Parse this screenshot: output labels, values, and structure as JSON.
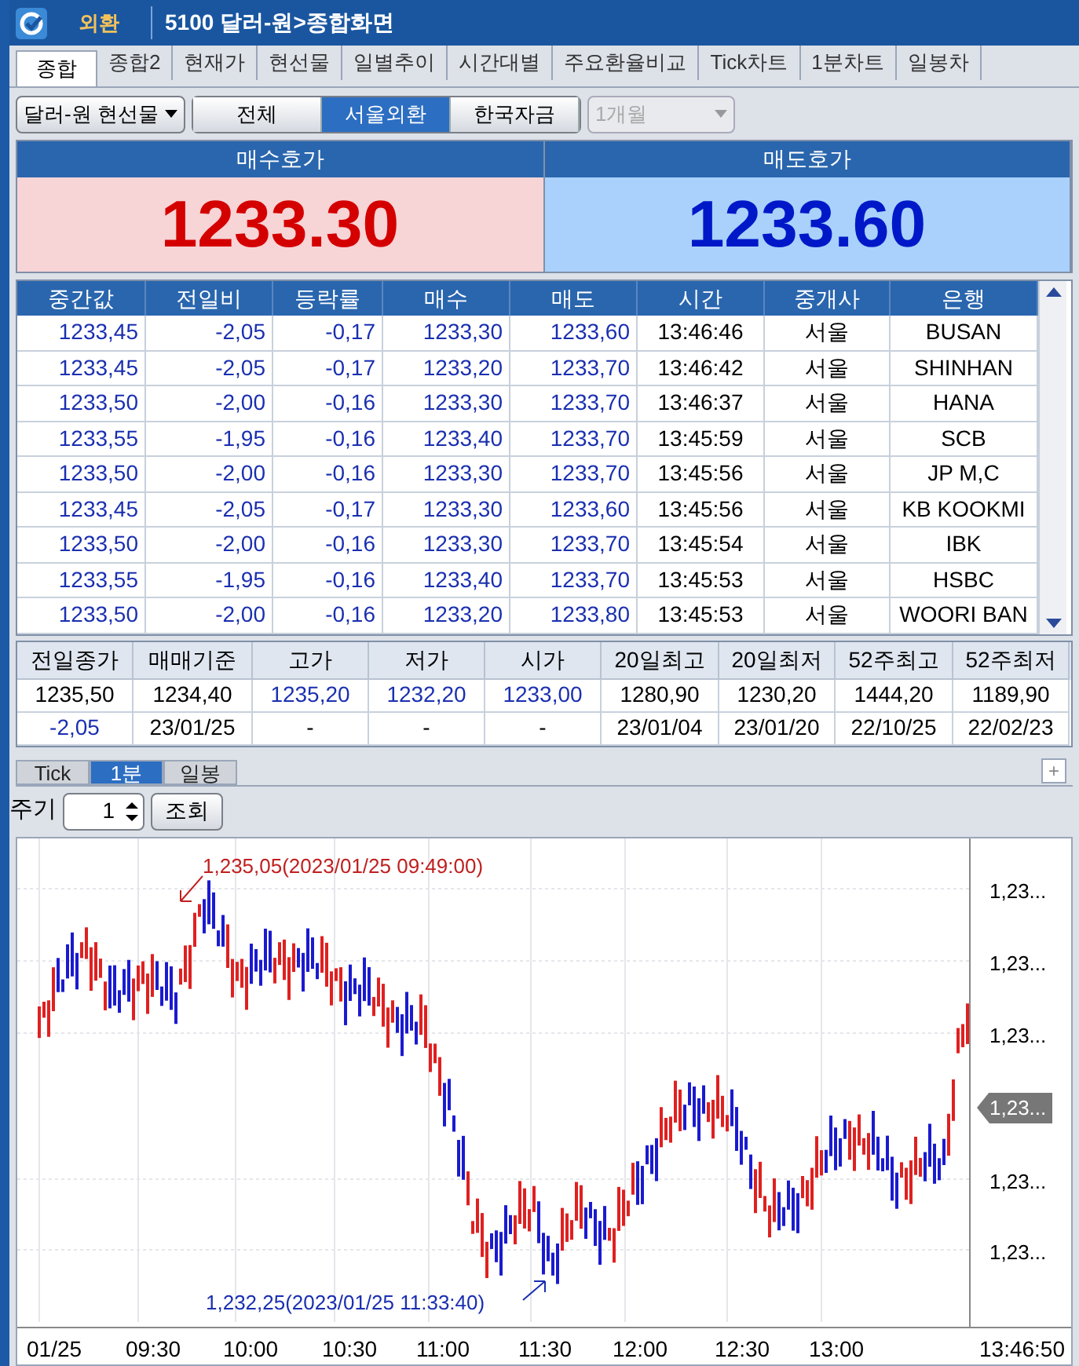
{
  "window": {
    "menu": "외환",
    "title": "5100 달러-원>종합화면"
  },
  "tabs": [
    {
      "label": "종합",
      "selected": true
    },
    {
      "label": "종합2",
      "selected": false
    },
    {
      "label": "현재가",
      "selected": false
    },
    {
      "label": "현선물",
      "selected": false
    },
    {
      "label": "일별추이",
      "selected": false
    },
    {
      "label": "시간대별",
      "selected": false
    },
    {
      "label": "주요환율비교",
      "selected": false
    },
    {
      "label": "Tick차트",
      "selected": false
    },
    {
      "label": "1분차트",
      "selected": false
    },
    {
      "label": "일봉차",
      "selected": false
    }
  ],
  "market_select": {
    "value": "달러-원 현선물"
  },
  "segments": [
    {
      "label": "전체",
      "selected": false
    },
    {
      "label": "서울외환",
      "selected": true
    },
    {
      "label": "한국자금",
      "selected": false
    }
  ],
  "period_select": {
    "value": "1개월",
    "disabled": true
  },
  "quotes": [
    {
      "label": "매수호가",
      "price": "1233.30",
      "color": "#d40000"
    },
    {
      "label": "매도호가",
      "price": "1233.60",
      "color": "#0018c8"
    }
  ],
  "table": {
    "columns": [
      {
        "label": "중간값",
        "color": "#1a2fb0"
      },
      {
        "label": "전일비",
        "color": "#1a2fb0"
      },
      {
        "label": "등락률",
        "color": "#1a2fb0"
      },
      {
        "label": "매수",
        "color": "#1a2fb0"
      },
      {
        "label": "매도",
        "color": "#1a2fb0"
      },
      {
        "label": "시간",
        "color": "#000000"
      },
      {
        "label": "중개사",
        "color": "#000000"
      },
      {
        "label": "은행",
        "color": "#000000"
      }
    ],
    "rows": [
      [
        "1233,45",
        "-2,05",
        "-0,17",
        "1233,30",
        "1233,60",
        "13:46:46",
        "서울",
        "BUSAN"
      ],
      [
        "1233,45",
        "-2,05",
        "-0,17",
        "1233,20",
        "1233,70",
        "13:46:42",
        "서울",
        "SHINHAN"
      ],
      [
        "1233,50",
        "-2,00",
        "-0,16",
        "1233,30",
        "1233,70",
        "13:46:37",
        "서울",
        "HANA"
      ],
      [
        "1233,55",
        "-1,95",
        "-0,16",
        "1233,40",
        "1233,70",
        "13:45:59",
        "서울",
        "SCB"
      ],
      [
        "1233,50",
        "-2,00",
        "-0,16",
        "1233,30",
        "1233,70",
        "13:45:56",
        "서울",
        "JP M,C"
      ],
      [
        "1233,45",
        "-2,05",
        "-0,17",
        "1233,30",
        "1233,60",
        "13:45:56",
        "서울",
        "KB KOOKMI"
      ],
      [
        "1233,50",
        "-2,00",
        "-0,16",
        "1233,30",
        "1233,70",
        "13:45:54",
        "서울",
        "IBK"
      ],
      [
        "1233,55",
        "-1,95",
        "-0,16",
        "1233,40",
        "1233,70",
        "13:45:53",
        "서울",
        "HSBC"
      ],
      [
        "1233,50",
        "-2,00",
        "-0,16",
        "1233,20",
        "1233,80",
        "13:45:53",
        "서울",
        "WOORI BAN"
      ]
    ]
  },
  "summary": {
    "columns": [
      "전일종가",
      "매매기준",
      "고가",
      "저가",
      "시가",
      "20일최고",
      "20일최저",
      "52주최고",
      "52주최저"
    ],
    "rows": [
      [
        {
          "text": "1235,50",
          "color": "#000000"
        },
        {
          "text": "1234,40",
          "color": "#000000"
        },
        {
          "text": "1235,20",
          "color": "#1a2fb0"
        },
        {
          "text": "1232,20",
          "color": "#1a2fb0"
        },
        {
          "text": "1233,00",
          "color": "#1a2fb0"
        },
        {
          "text": "1280,90",
          "color": "#000000"
        },
        {
          "text": "1230,20",
          "color": "#000000"
        },
        {
          "text": "1444,20",
          "color": "#000000"
        },
        {
          "text": "1189,90",
          "color": "#000000"
        }
      ],
      [
        {
          "text": "-2,05",
          "color": "#1a2fb0"
        },
        {
          "text": "23/01/25",
          "color": "#000000"
        },
        {
          "text": "-",
          "color": "#000000"
        },
        {
          "text": "-",
          "color": "#000000"
        },
        {
          "text": "-",
          "color": "#000000"
        },
        {
          "text": "23/01/04",
          "color": "#000000"
        },
        {
          "text": "23/01/20",
          "color": "#000000"
        },
        {
          "text": "22/10/25",
          "color": "#000000"
        },
        {
          "text": "22/02/23",
          "color": "#000000"
        }
      ]
    ]
  },
  "chart_tabs": [
    {
      "label": "Tick",
      "selected": false
    },
    {
      "label": "1분",
      "selected": true
    },
    {
      "label": "일봉",
      "selected": false
    }
  ],
  "add_button": "+",
  "period": {
    "label": "주기",
    "value": "1",
    "button": "조회"
  },
  "chart": {
    "high_note": "1,235,05(2023/01/25 09:49:00)",
    "low_note": "1,232,25(2023/01/25 11:33:40)",
    "y_labels": [
      "1,23...",
      "1,23...",
      "1,23...",
      "1,23...",
      "1,23..."
    ],
    "current_tag": "1,23...",
    "x_labels": [
      "01/25",
      "09:30",
      "10:00",
      "10:30",
      "11:00",
      "11:30",
      "12:00",
      "12:30",
      "13:00"
    ],
    "last_time": "13:46:50"
  }
}
